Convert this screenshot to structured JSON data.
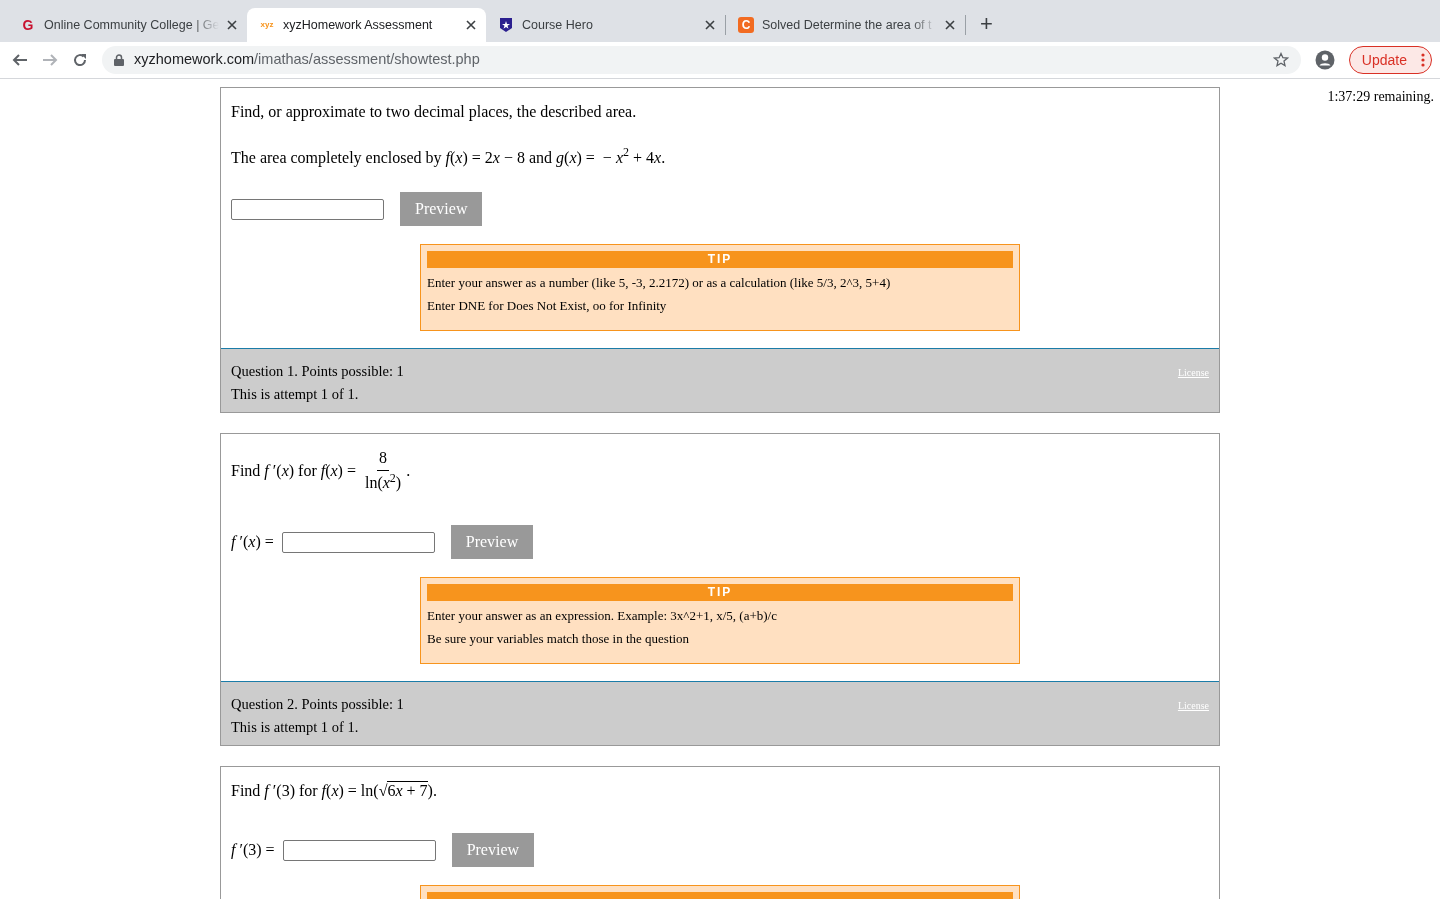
{
  "browser": {
    "tabs": [
      {
        "title": "Online Community College | Ge",
        "icon_text": "G",
        "selected": false
      },
      {
        "title": "xyzHomework Assessment",
        "icon_text": "xyz",
        "selected": true
      },
      {
        "title": "Course Hero",
        "selected": false
      },
      {
        "title": "Solved Determine the area of t",
        "icon_text": "C",
        "selected": false
      }
    ],
    "new_tab": "+",
    "url_host": "xyzhomework.com",
    "url_path": "/imathas/assessment/showtest.php",
    "update_button": "Update"
  },
  "timer": "1:37:29 remaining.",
  "questions": [
    {
      "intro": "Find, or approximate to two decimal places, the described area.",
      "prompt": [
        {
          "kind": "text",
          "text": "The area completely enclosed by "
        },
        {
          "kind": "math",
          "text": "f(x) = 2x − 8"
        },
        {
          "kind": "text",
          "text": " and "
        },
        {
          "kind": "math",
          "text": "g(x) =  − x"
        },
        {
          "kind": "sup",
          "text": "2"
        },
        {
          "kind": "math",
          "text": " + 4x"
        },
        {
          "kind": "text",
          "text": "."
        }
      ],
      "preview": "Preview",
      "tip": {
        "title": "TIP",
        "lines": [
          "Enter your answer as a number (like 5, -3, 2.2172) or as a calculation (like 5/3, 2^3, 5+4)",
          "Enter DNE for Does Not Exist, oo for Infinity"
        ]
      },
      "info": [
        "Question 1. Points possible: 1",
        "This is attempt 1 of 1."
      ],
      "license": "License"
    },
    {
      "prompt": [
        {
          "kind": "text",
          "text": "Find "
        },
        {
          "kind": "math",
          "text": "f ′(x)"
        },
        {
          "kind": "text",
          "text": " for "
        },
        {
          "kind": "math",
          "text": "f(x) = "
        },
        {
          "kind": "fraction",
          "num": [
            {
              "kind": "math",
              "text": "8"
            }
          ],
          "den": [
            {
              "kind": "math",
              "text": "ln(x"
            },
            {
              "kind": "sup",
              "text": "2"
            },
            {
              "kind": "math",
              "text": ")"
            }
          ]
        },
        {
          "kind": "text",
          "text": "."
        }
      ],
      "answer_label": "f ′(x) =",
      "preview": "Preview",
      "tip": {
        "title": "TIP",
        "lines": [
          "Enter your answer as an expression. Example: 3x^2+1, x/5, (a+b)/c",
          "Be sure your variables match those in the question"
        ]
      },
      "info": [
        "Question 2. Points possible: 1",
        "This is attempt 1 of 1."
      ],
      "license": "License"
    },
    {
      "prompt": [
        {
          "kind": "text",
          "text": "Find "
        },
        {
          "kind": "math",
          "text": "f ′(3)"
        },
        {
          "kind": "text",
          "text": " for "
        },
        {
          "kind": "math",
          "text": "f(x) = ln("
        },
        {
          "kind": "sqrt",
          "sign": "√",
          "radicand": [
            {
              "kind": "math",
              "text": "6x + 7"
            }
          ]
        },
        {
          "kind": "math",
          "text": ")"
        },
        {
          "kind": "text",
          "text": "."
        }
      ],
      "answer_label": "f ′(3) =",
      "preview": "Preview",
      "tip": {
        "cut": true
      }
    }
  ]
}
